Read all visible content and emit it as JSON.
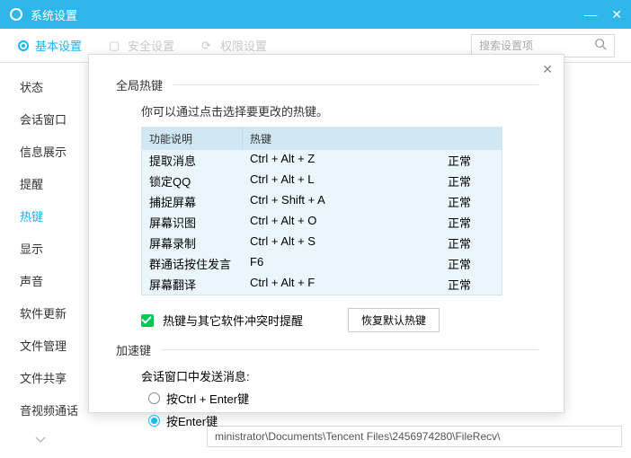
{
  "window": {
    "title": "系统设置"
  },
  "tabs": {
    "items": [
      "基本设置",
      "安全设置",
      "权限设置"
    ],
    "search_placeholder": "搜索设置项"
  },
  "sidebar": {
    "items": [
      "状态",
      "会话窗口",
      "信息展示",
      "提醒",
      "热键",
      "显示",
      "声音",
      "软件更新",
      "文件管理",
      "文件共享",
      "音视频通话"
    ]
  },
  "dialog": {
    "global": {
      "title": "全局热键",
      "desc": "你可以通过点击选择要更改的热键。",
      "col_func": "功能说明",
      "col_hotkey": "热键",
      "rows": [
        {
          "func": "提取消息",
          "hk": "Ctrl + Alt + Z",
          "status": "正常"
        },
        {
          "func": "锁定QQ",
          "hk": "Ctrl + Alt + L",
          "status": "正常"
        },
        {
          "func": "捕捉屏幕",
          "hk": "Ctrl + Shift + A",
          "status": "正常"
        },
        {
          "func": "屏幕识图",
          "hk": "Ctrl + Alt + O",
          "status": "正常"
        },
        {
          "func": "屏幕录制",
          "hk": "Ctrl + Alt + S",
          "status": "正常"
        },
        {
          "func": "群通话按住发言",
          "hk": "F6",
          "status": "正常"
        },
        {
          "func": "屏幕翻译",
          "hk": "Ctrl + Alt + F",
          "status": "正常"
        }
      ],
      "conflict_label": "热键与其它软件冲突时提醒",
      "restore_label": "恢复默认热键"
    },
    "accel": {
      "title": "加速键",
      "send_label": "会话窗口中发送消息:",
      "opt1": "按Ctrl + Enter键",
      "opt2": "按Enter键"
    }
  },
  "path_bar": "ministrator\\Documents\\Tencent Files\\2456974280\\FileRecv\\"
}
